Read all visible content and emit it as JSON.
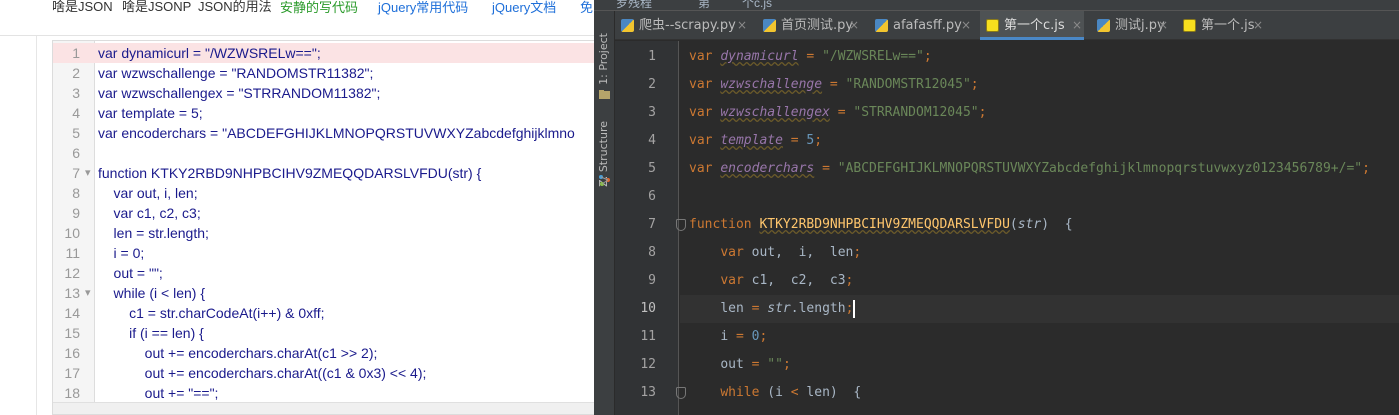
{
  "browser": {
    "nav_links": [
      "啥是JSON",
      "啥是JSONP",
      "JSON的用法",
      "安静的写代码",
      "jQuery常用代码",
      "jQuery文档",
      "免"
    ],
    "editor": {
      "lines": [
        {
          "num": "1",
          "code": "var dynamicurl = \"/WZWSRELw==\";"
        },
        {
          "num": "2",
          "code": "var wzwschallenge = \"RANDOMSTR11382\";"
        },
        {
          "num": "3",
          "code": "var wzwschallengex = \"STRRANDOM11382\";"
        },
        {
          "num": "4",
          "code": "var template = 5;"
        },
        {
          "num": "5",
          "code": "var encoderchars = \"ABCDEFGHIJKLMNOPQRSTUVWXYZabcdefghijklmno"
        },
        {
          "num": "6",
          "code": ""
        },
        {
          "num": "7",
          "code": "function KTKY2RBD9NHPBCIHV9ZMEQQDARSLVFDU(str) {"
        },
        {
          "num": "8",
          "code": "    var out, i, len;"
        },
        {
          "num": "9",
          "code": "    var c1, c2, c3;"
        },
        {
          "num": "10",
          "code": "    len = str.length;"
        },
        {
          "num": "11",
          "code": "    i = 0;"
        },
        {
          "num": "12",
          "code": "    out = \"\";"
        },
        {
          "num": "13",
          "code": "    while (i < len) {"
        },
        {
          "num": "14",
          "code": "        c1 = str.charCodeAt(i++) & 0xff;"
        },
        {
          "num": "15",
          "code": "        if (i == len) {"
        },
        {
          "num": "16",
          "code": "            out += encoderchars.charAt(c1 >> 2);"
        },
        {
          "num": "17",
          "code": "            out += encoderchars.charAt((c1 & 0x3) << 4);"
        },
        {
          "num": "18",
          "code": "            out += \"==\";"
        }
      ]
    }
  },
  "ide": {
    "top_strip": [
      "罗残程",
      "第",
      "个c.js"
    ],
    "side_tabs": {
      "project": "1: Project",
      "structure": "Z: Structure"
    },
    "tabs": [
      {
        "label": "爬虫--scrapy.py",
        "type": "py",
        "active": false
      },
      {
        "label": "首页测试.py",
        "type": "py",
        "active": false
      },
      {
        "label": "afafasff.py",
        "type": "py",
        "active": false
      },
      {
        "label": "第一个c.js",
        "type": "js",
        "active": true
      },
      {
        "label": "测试j.py",
        "type": "py",
        "active": false
      },
      {
        "label": "第一个.js",
        "type": "js",
        "active": false
      }
    ],
    "close_glyph": "×",
    "code_lines": [
      {
        "num": "1"
      },
      {
        "num": "2"
      },
      {
        "num": "3"
      },
      {
        "num": "4"
      },
      {
        "num": "5"
      },
      {
        "num": "6"
      },
      {
        "num": "7"
      },
      {
        "num": "8"
      },
      {
        "num": "9"
      },
      {
        "num": "10"
      },
      {
        "num": "11"
      },
      {
        "num": "12"
      },
      {
        "num": "13"
      }
    ],
    "code_tokens": {
      "l1": [
        "var",
        "dynamicurl",
        "=",
        "\"/WZWSRELw==\"",
        ";"
      ],
      "l2": [
        "var",
        "wzwschallenge",
        "=",
        "\"RANDOMSTR12045\"",
        ";"
      ],
      "l3": [
        "var",
        "wzwschallengex",
        "=",
        "\"STRRANDOM12045\"",
        ";"
      ],
      "l4": [
        "var",
        "template",
        "=",
        "5",
        ";"
      ],
      "l5": [
        "var",
        "encoderchars",
        "=",
        "\"ABCDEFGHIJKLMNOPQRSTUVWXYZabcdefghijklmnopqrstuvwxyz0123456789+/=\"",
        ";"
      ],
      "l7": [
        "function",
        "KTKY2RBD9NHPBCIHV9ZMEQQDARSLVFDU",
        "(",
        "str",
        ")  {"
      ],
      "l8": [
        "var",
        "out,  i,  len",
        ";"
      ],
      "l9": [
        "var",
        "c1,  c2,  c3",
        ";"
      ],
      "l10": [
        "len",
        "=",
        "str",
        ".length",
        ";"
      ],
      "l11": [
        "i",
        "=",
        "0",
        ";"
      ],
      "l12": [
        "out",
        "=",
        "\"\"",
        ";"
      ],
      "l13": [
        "while",
        "(i",
        "<",
        "len)  {"
      ]
    }
  }
}
